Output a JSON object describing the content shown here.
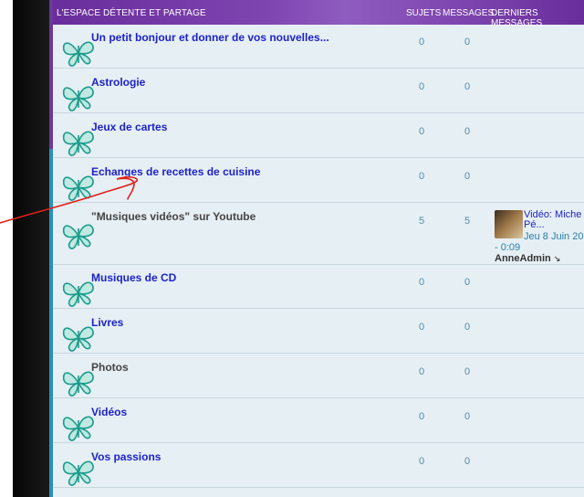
{
  "header": {
    "category": "L'ESPACE DÉTENTE ET PARTAGE",
    "col_sujets": "SUJETS",
    "col_messages": "MESSAGES",
    "col_derniers": "DERNIERS MESSAGES"
  },
  "forums": [
    {
      "title": "Un petit bonjour et donner de vos nouvelles...",
      "sujets": "0",
      "messages": "0"
    },
    {
      "title": "Astrologie",
      "sujets": "0",
      "messages": "0"
    },
    {
      "title": "Jeux de cartes",
      "sujets": "0",
      "messages": "0"
    },
    {
      "title": "Echanges de recettes de cuisine",
      "sujets": "0",
      "messages": "0"
    },
    {
      "title": "\"Musiques vidéos\" sur Youtube",
      "sujets": "5",
      "messages": "5"
    },
    {
      "title": "Musiques de CD",
      "sujets": "0",
      "messages": "0"
    },
    {
      "title": "Livres",
      "sujets": "0",
      "messages": "0"
    },
    {
      "title": "Photos",
      "sujets": "0",
      "messages": "0"
    },
    {
      "title": "Vidéos",
      "sujets": "0",
      "messages": "0"
    },
    {
      "title": "Vos passions",
      "sujets": "0",
      "messages": "0"
    }
  ],
  "last_post": {
    "title_line1": "Vidéo: Miche",
    "title_line2": "Pé...",
    "date": "Jeu 8 Juin 20",
    "time": "- 0:09",
    "user": "AnneAdmin",
    "goto_icon": "goto-last-post-icon"
  },
  "colors": {
    "header_purple": "#6a2d9c",
    "link_blue": "#1e22c8",
    "row_bg": "#e6eff4",
    "annotation_red": "#e0201a"
  }
}
